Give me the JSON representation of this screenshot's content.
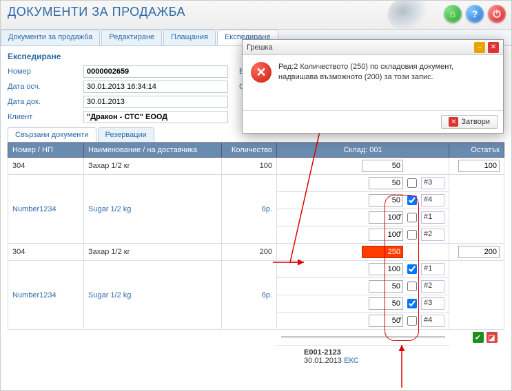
{
  "header": {
    "title": "ДОКУМЕНТИ ЗА ПРОДАЖБА"
  },
  "tabs": {
    "items": [
      "Документи за продажба",
      "Редактиране",
      "Плащания",
      "Експедиране"
    ],
    "active": 3
  },
  "section_title": "Експедиране",
  "form": {
    "rows": [
      {
        "label": "Номер",
        "value": "0000002659",
        "extra": "Вид"
      },
      {
        "label": "Дата осч.",
        "value": "30.01.2013 16:34:14",
        "extra": "Склад"
      },
      {
        "label": "Дата док.",
        "value": "30.01.2013",
        "extra": ""
      },
      {
        "label": "Клиент",
        "value": "\"Дракон - СТС\" ЕООД",
        "bold": true,
        "extra": ""
      }
    ]
  },
  "subtabs": {
    "items": [
      "Свързани документи",
      "Резервации"
    ],
    "active": 0
  },
  "grid": {
    "headers": {
      "c0": "Номер / НП",
      "c1": "Наименование / на доставчика",
      "c2": "Количество",
      "c3": "Склад: 001",
      "c4": "Остатък"
    },
    "groups": [
      {
        "row1": {
          "num": "304",
          "name": "Захар 1/2 кг",
          "qty": "100",
          "wh_val": "50",
          "rest": "100"
        },
        "row2": {
          "num": "Number1234",
          "name": "Sugar 1/2 kg",
          "unit": "бр."
        },
        "details": [
          {
            "val": "50",
            "chk": false,
            "tag": "#3"
          },
          {
            "val": "50",
            "chk": true,
            "tag": "#4"
          },
          {
            "val": "100",
            "mini": true,
            "chk": false,
            "tag": "#1"
          },
          {
            "val": "100",
            "mini": true,
            "chk": false,
            "tag": "#2"
          }
        ]
      },
      {
        "row1": {
          "num": "304",
          "name": "Захар 1/2 кг",
          "qty": "200",
          "wh_val": "250",
          "wh_error": true,
          "rest": "200"
        },
        "row2": {
          "num": "Number1234",
          "name": "Sugar 1/2 kg",
          "unit": "бр."
        },
        "details": [
          {
            "val": "100",
            "chk": true,
            "tag": "#1"
          },
          {
            "val": "50",
            "chk": false,
            "tag": "#2"
          },
          {
            "val": "50",
            "chk": true,
            "tag": "#3"
          },
          {
            "val": "50",
            "mini": true,
            "chk": false,
            "tag": "#4"
          }
        ]
      }
    ],
    "footer": {
      "code": "E001-2123",
      "date": "30.01.2013",
      "eks": "ЕКС"
    }
  },
  "dialog": {
    "title": "Грешка",
    "message": "Ред:2 Количеството (250) по складовия документ, надвишава възможното (200) за този запис.",
    "close_label": "Затвори"
  }
}
